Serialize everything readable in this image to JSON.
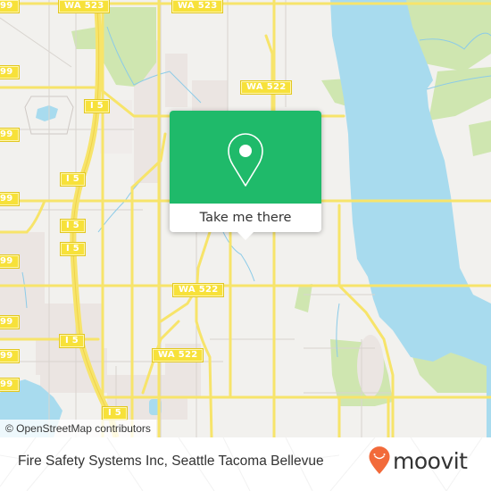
{
  "map": {
    "attribution": "© OpenStreetMap contributors",
    "route_shields": [
      {
        "id": "wa523-west",
        "label": "WA 523"
      },
      {
        "id": "wa523-east",
        "label": "WA 523"
      },
      {
        "id": "wa522-north",
        "label": "WA 522"
      },
      {
        "id": "wa522-mid",
        "label": "WA 522"
      },
      {
        "id": "wa522-south",
        "label": "WA 522"
      },
      {
        "id": "i5-1",
        "label": "I 5"
      },
      {
        "id": "i5-2",
        "label": "I 5"
      },
      {
        "id": "i5-3",
        "label": "I 5"
      },
      {
        "id": "i5-4",
        "label": "I 5"
      },
      {
        "id": "i5-5",
        "label": "I 5"
      },
      {
        "id": "i5-6",
        "label": "I 5"
      },
      {
        "id": "r99-1",
        "label": "99"
      },
      {
        "id": "r99-2",
        "label": "99"
      },
      {
        "id": "r99-3",
        "label": "99"
      },
      {
        "id": "r99-4",
        "label": "99"
      },
      {
        "id": "r99-5",
        "label": "99"
      },
      {
        "id": "r99-6",
        "label": "99"
      },
      {
        "id": "r99-7",
        "label": "99"
      },
      {
        "id": "r99-8",
        "label": "99"
      }
    ],
    "colors": {
      "land": "#f2f1ee",
      "water": "#a8dbee",
      "park": "#cfe6b0",
      "road_major": "#f7e46a",
      "road_minor": "#d8d4cf",
      "urban": "#e9e2e0"
    }
  },
  "popup": {
    "icon": "map-pin-icon",
    "button_label": "Take me there",
    "color": "#1fba6a"
  },
  "footer": {
    "place_name": "Fire Safety Systems Inc, Seattle Tacoma Bellevue",
    "brand": "moovit",
    "brand_icon": "moovit-pin-logo-icon",
    "brand_color": "#f26a3a"
  }
}
